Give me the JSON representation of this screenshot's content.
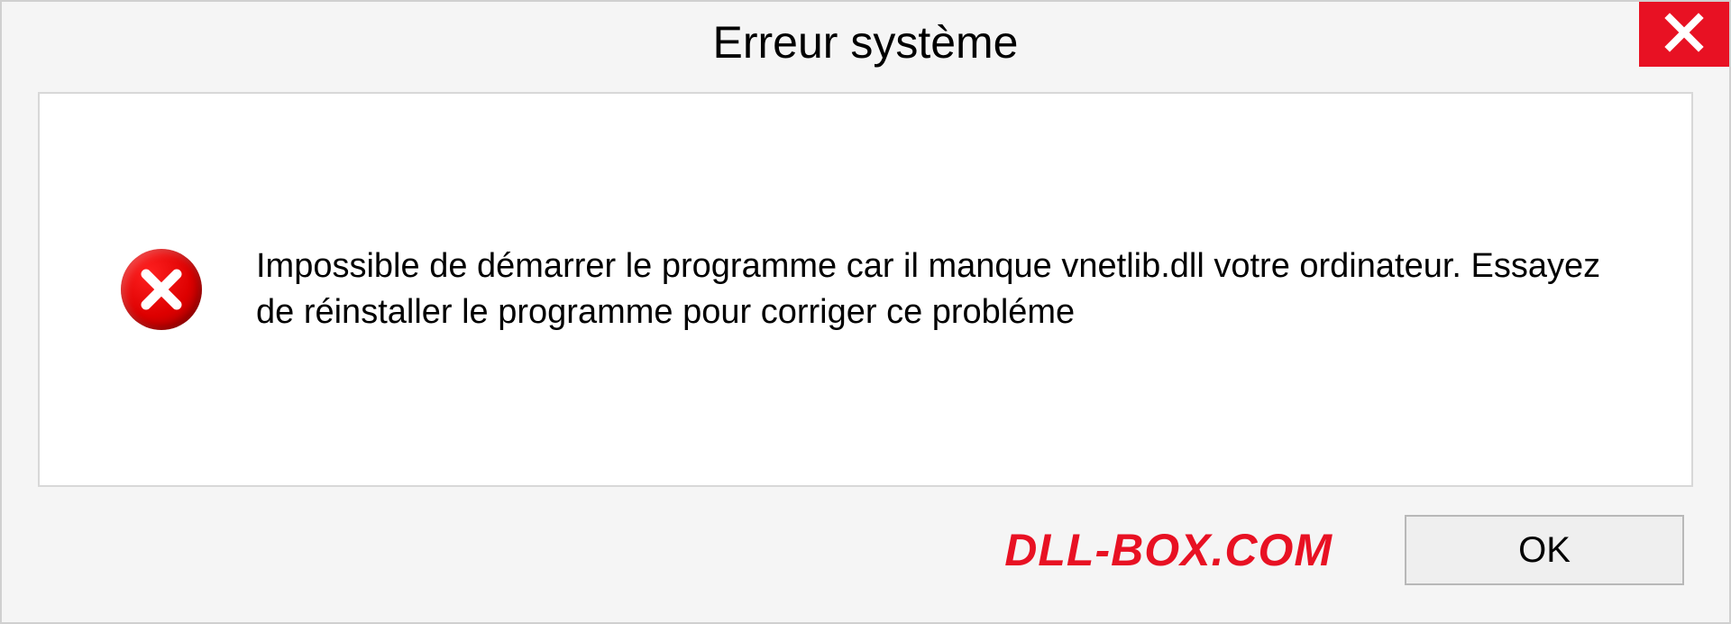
{
  "dialog": {
    "title": "Erreur système",
    "message": "Impossible de démarrer le programme car il manque vnetlib.dll votre ordinateur. Essayez de réinstaller le programme pour corriger ce probléme",
    "ok_label": "OK",
    "brand": "DLL-BOX.COM"
  },
  "icons": {
    "close": "close-icon",
    "error": "error-icon"
  },
  "colors": {
    "close_bg": "#e81123",
    "error_bg": "#cc0000",
    "brand": "#e81123",
    "panel_bg": "#ffffff",
    "dialog_bg": "#f5f5f5"
  }
}
